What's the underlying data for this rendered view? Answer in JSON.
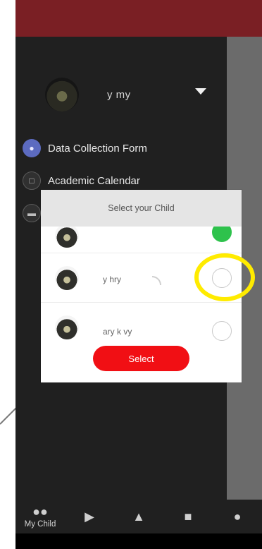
{
  "profile": {
    "name": "y   my"
  },
  "menu": {
    "items": [
      {
        "label": "Data Collection Form",
        "icon": "user-icon"
      },
      {
        "label": "Academic Calendar",
        "icon": "calendar-icon"
      },
      {
        "label": "",
        "icon": "chat-icon"
      }
    ]
  },
  "modal": {
    "title": "Select your Child",
    "children": [
      {
        "name": "",
        "selected": true
      },
      {
        "name": "y hry",
        "selected": false
      },
      {
        "name": "ary  k  vy",
        "selected": false
      }
    ],
    "button_label": "Select"
  },
  "bottom_nav": {
    "items": [
      {
        "label": "My Child",
        "icon": "my-child-icon"
      },
      {
        "label": "",
        "icon": "megaphone-icon"
      },
      {
        "label": "",
        "icon": "cart-icon"
      },
      {
        "label": "",
        "icon": "school-icon"
      },
      {
        "label": "",
        "icon": "people-icon"
      }
    ]
  },
  "colors": {
    "topbar": "#7a1f24",
    "accent_red": "#f10f14",
    "selected_green": "#2ec24c",
    "highlight_yellow": "#ffeb00"
  }
}
